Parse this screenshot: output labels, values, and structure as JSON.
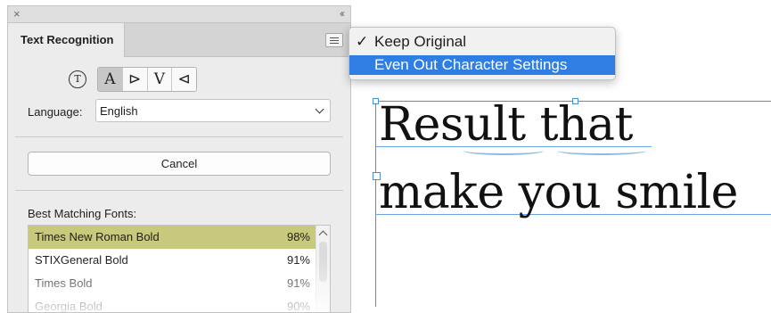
{
  "panel": {
    "close_icon": "×",
    "collapse_icon": "‹‹",
    "tab_title": "Text Recognition",
    "mode_buttons": [
      "A",
      "⊳",
      "V",
      "⊲"
    ],
    "language": {
      "label": "Language:",
      "value": "English"
    },
    "cancel_label": "Cancel",
    "fonts_label": "Best Matching Fonts:",
    "fonts": [
      {
        "name": "Times New Roman Bold",
        "match": "98%"
      },
      {
        "name": "STIXGeneral Bold",
        "match": "91%"
      },
      {
        "name": "Times Bold",
        "match": "91%"
      },
      {
        "name": "Georgia Bold",
        "match": "90%"
      }
    ]
  },
  "popup_menu": {
    "items": [
      {
        "check": "✓",
        "label": "Keep Original"
      },
      {
        "check": "",
        "label": "Even Out Character Settings"
      }
    ]
  },
  "canvas": {
    "line1": "Result that",
    "line2": "make you smile"
  },
  "colors": {
    "selection": "#c8c97c",
    "highlight": "#2f7ee3",
    "frame": "#4a8fdc"
  }
}
